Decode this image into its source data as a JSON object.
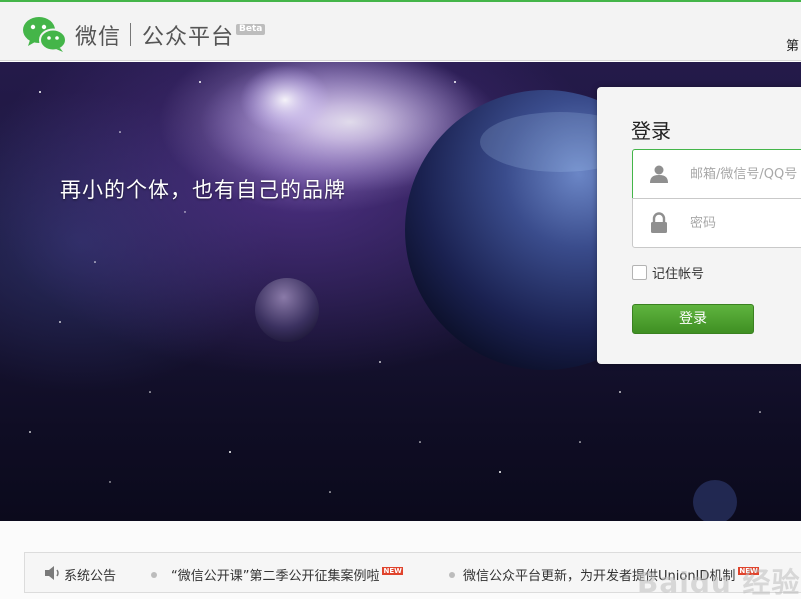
{
  "header": {
    "logo_icon": "wechat-logo-icon",
    "logo_wechat": "微信",
    "logo_platform": "公众平台",
    "beta_badge": "Beta",
    "right_text": "第",
    "accent_color": "#44b549"
  },
  "banner": {
    "slogan": "再小的个体，也有自己的品牌"
  },
  "login": {
    "title": "登录",
    "username_placeholder": "邮箱/微信号/QQ号",
    "username_icon": "user-icon",
    "password_placeholder": "密码",
    "password_icon": "lock-icon",
    "remember_label": "记住帐号",
    "remember_checked": false,
    "submit_label": "登录",
    "button_color": "#4fa431"
  },
  "notice": {
    "icon": "speaker-icon",
    "title": "系统公告",
    "items": [
      {
        "text": "“微信公开课”第二季公开征集案例啦",
        "badge": "NEW"
      },
      {
        "text": "微信公众平台更新，为开发者提供UnionID机制",
        "badge": "NEW"
      }
    ],
    "watermark": "Baidu 经验",
    "badge_color": "#e0442d"
  }
}
